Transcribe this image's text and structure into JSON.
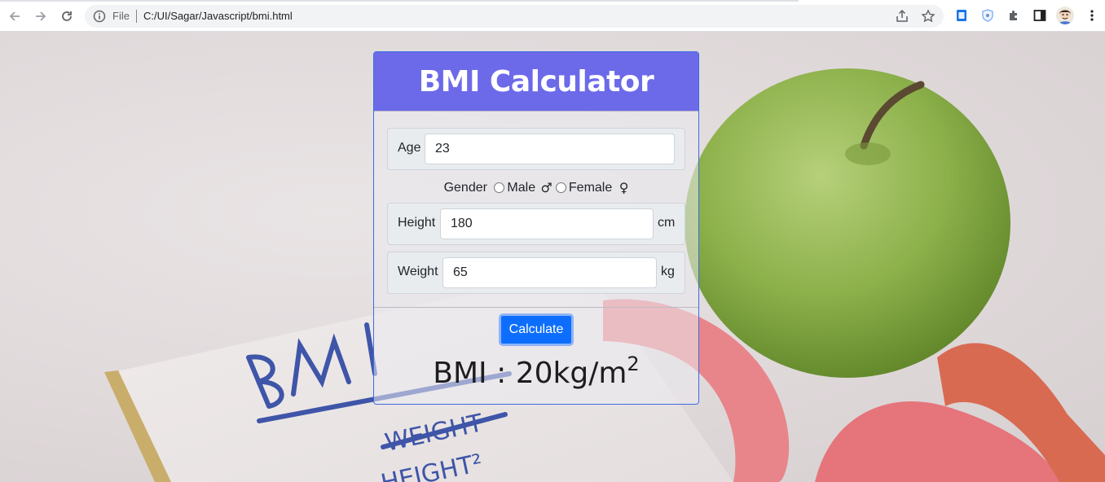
{
  "browser": {
    "omnibox": {
      "scheme_label": "File",
      "url": "C:/UI/Sagar/Javascript/bmi.html"
    }
  },
  "icons": {
    "back": "arrow-left",
    "forward": "arrow-right",
    "reload": "reload",
    "info": "info-circle",
    "share": "share",
    "bookmark": "star",
    "extensions": [
      "docs-extension",
      "shield-extension",
      "puzzle-extensions",
      "side-panel"
    ],
    "profile": "avatar",
    "menu": "kebab-menu"
  },
  "colors": {
    "header": "#6c6ae9",
    "button": "#0d6efd",
    "card_border": "#3c6be0"
  },
  "app": {
    "title": "BMI Calculator",
    "age": {
      "label": "Age",
      "value": "23"
    },
    "gender": {
      "label": "Gender",
      "options": [
        {
          "label": "Male",
          "symbol": "♂",
          "checked": false
        },
        {
          "label": "Female",
          "symbol": "♀",
          "checked": false
        }
      ]
    },
    "height": {
      "label": "Height",
      "value": "180",
      "unit": "cm"
    },
    "weight": {
      "label": "Weight",
      "value": "65",
      "unit": "kg"
    },
    "calculate_label": "Calculate",
    "result": {
      "prefix": "BMI : 20kg/m",
      "superscript": "2"
    }
  }
}
